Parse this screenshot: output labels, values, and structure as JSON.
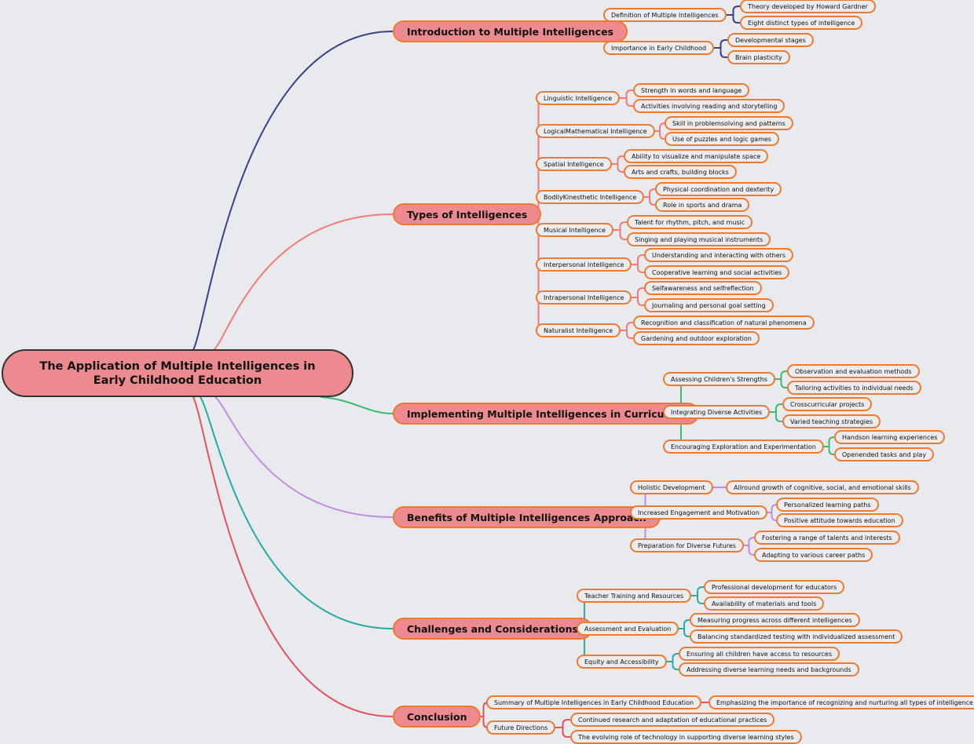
{
  "root": {
    "title": "The Application of Multiple Intelligences in Early Childhood Education"
  },
  "colors": {
    "node_fill": "#ec8a90",
    "node_border": "#ee7a30",
    "background": "#e9eaee"
  },
  "branches": [
    {
      "label": "Introduction to Multiple Intelligences",
      "color": "#3c3f8a",
      "children": [
        {
          "label": "Definition of Multiple Intelligences",
          "children": [
            "Theory developed by Howard Gardner",
            "Eight distinct types of intelligence"
          ]
        },
        {
          "label": "Importance in Early Childhood",
          "children": [
            "Developmental stages",
            "Brain plasticity"
          ]
        }
      ]
    },
    {
      "label": "Types of Intelligences",
      "color": "#f47a78",
      "children": [
        {
          "label": "Linguistic Intelligence",
          "children": [
            "Strength in words and language",
            "Activities involving reading and storytelling"
          ]
        },
        {
          "label": "LogicalMathematical Intelligence",
          "children": [
            "Skill in problemsolving and patterns",
            "Use of puzzles and logic games"
          ]
        },
        {
          "label": "Spatial Intelligence",
          "children": [
            "Ability to visualize and manipulate space",
            "Arts and crafts, building blocks"
          ]
        },
        {
          "label": "BodilyKinesthetic Intelligence",
          "children": [
            "Physical coordination and dexterity",
            "Role in sports and drama"
          ]
        },
        {
          "label": "Musical Intelligence",
          "children": [
            "Talent for rhythm, pitch, and music",
            "Singing and playing musical instruments"
          ]
        },
        {
          "label": "Interpersonal Intelligence",
          "children": [
            "Understanding and interacting with others",
            "Cooperative learning and social activities"
          ]
        },
        {
          "label": "Intrapersonal Intelligence",
          "children": [
            "Selfawareness and selfreflection",
            "Journaling and personal goal setting"
          ]
        },
        {
          "label": "Naturalist Intelligence",
          "children": [
            "Recognition and classification of natural phenomena",
            "Gardening and outdoor exploration"
          ]
        }
      ]
    },
    {
      "label": "Implementing Multiple Intelligences in Curriculum",
      "color": "#3dba72",
      "children": [
        {
          "label": "Assessing Children's Strengths",
          "children": [
            "Observation and evaluation methods",
            "Tailoring activities to individual needs"
          ]
        },
        {
          "label": "Integrating Diverse Activities",
          "children": [
            "Crosscurricular projects",
            "Varied teaching strategies"
          ]
        },
        {
          "label": "Encouraging Exploration and Experimentation",
          "children": [
            "Handson learning experiences",
            "Openended tasks and play"
          ]
        }
      ]
    },
    {
      "label": "Benefits of Multiple Intelligences Approach",
      "color": "#c08ee0",
      "children": [
        {
          "label": "Holistic Development",
          "children": [
            "Allround growth of cognitive, social, and emotional skills"
          ]
        },
        {
          "label": "Increased Engagement and Motivation",
          "children": [
            "Personalized learning paths",
            "Positive attitude towards education"
          ]
        },
        {
          "label": "Preparation for Diverse Futures",
          "children": [
            "Fostering a range of talents and interests",
            "Adapting to various career paths"
          ]
        }
      ]
    },
    {
      "label": "Challenges and Considerations",
      "color": "#27aaa2",
      "children": [
        {
          "label": "Teacher Training and Resources",
          "children": [
            "Professional development for educators",
            "Availability of materials and tools"
          ]
        },
        {
          "label": "Assessment and Evaluation",
          "children": [
            "Measuring progress across different intelligences",
            "Balancing standardized testing with individualized assessment"
          ]
        },
        {
          "label": "Equity and Accessibility",
          "children": [
            "Ensuring all children have access to resources",
            "Addressing diverse learning needs and backgrounds"
          ]
        }
      ]
    },
    {
      "label": "Conclusion",
      "color": "#e4505e",
      "children": [
        {
          "label": "Summary of Multiple Intelligences in Early Childhood Education",
          "children": [
            "Emphasizing the importance of recognizing and nurturing all types of intelligence"
          ]
        },
        {
          "label": "Future Directions",
          "children": [
            "Continued research and adaptation of educational practices",
            "The evolving role of technology in supporting diverse learning styles"
          ]
        }
      ]
    }
  ]
}
